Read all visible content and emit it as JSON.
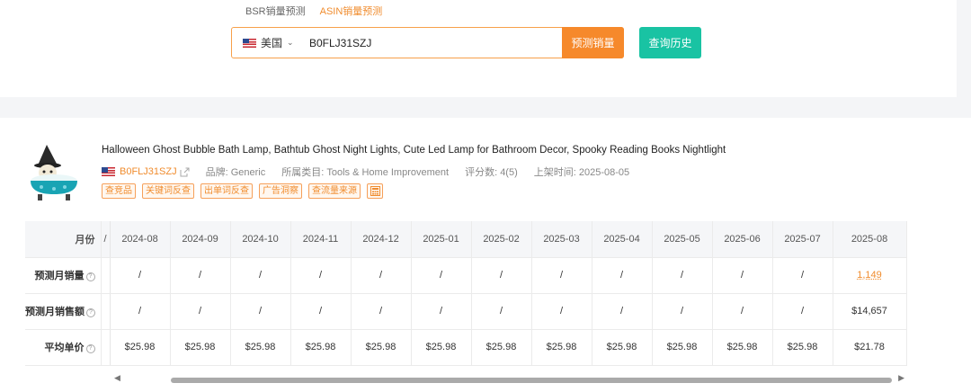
{
  "tabs": [
    {
      "label": "BSR销量预测",
      "active": false
    },
    {
      "label": "ASIN销量预测",
      "active": true
    }
  ],
  "search": {
    "country_label": "美国",
    "asin_value": "B0FLJ31SZJ",
    "predict_button": "预测销量",
    "history_button": "查询历史"
  },
  "product": {
    "title": "Halloween Ghost Bubble Bath Lamp, Bathtub Ghost Night Lights, Cute Led Lamp for Bathroom Decor, Spooky Reading Books Nightlight",
    "asin": "B0FLJ31SZJ",
    "brand": "品牌: Generic",
    "category": "所属类目: Tools & Home Improvement",
    "rating": "评分数: 4(5)",
    "launch_date": "上架时间: 2025-08-05",
    "actions": [
      "查竞品",
      "关键词反查",
      "出单词反查",
      "广告洞察",
      "查流量来源"
    ]
  },
  "table": {
    "month_header": "月份",
    "sep_mark": "/",
    "months": [
      "2024-08",
      "2024-09",
      "2024-10",
      "2024-11",
      "2024-12",
      "2025-01",
      "2025-02",
      "2025-03",
      "2025-04",
      "2025-05",
      "2025-06",
      "2025-07",
      "2025-08"
    ],
    "rows": [
      {
        "label": "预测月销量",
        "values": [
          "/",
          "/",
          "/",
          "/",
          "/",
          "/",
          "/",
          "/",
          "/",
          "/",
          "/",
          "/",
          "1,149"
        ]
      },
      {
        "label": "预测月销售额",
        "values": [
          "/",
          "/",
          "/",
          "/",
          "/",
          "/",
          "/",
          "/",
          "/",
          "/",
          "/",
          "/",
          "$14,657"
        ]
      },
      {
        "label": "平均单价",
        "values": [
          "$25.98",
          "$25.98",
          "$25.98",
          "$25.98",
          "$25.98",
          "$25.98",
          "$25.98",
          "$25.98",
          "$25.98",
          "$25.98",
          "$25.98",
          "$25.98",
          "$21.78"
        ]
      }
    ]
  },
  "colors": {
    "accent_orange": "#f6892b",
    "accent_green": "#19c3a3"
  }
}
